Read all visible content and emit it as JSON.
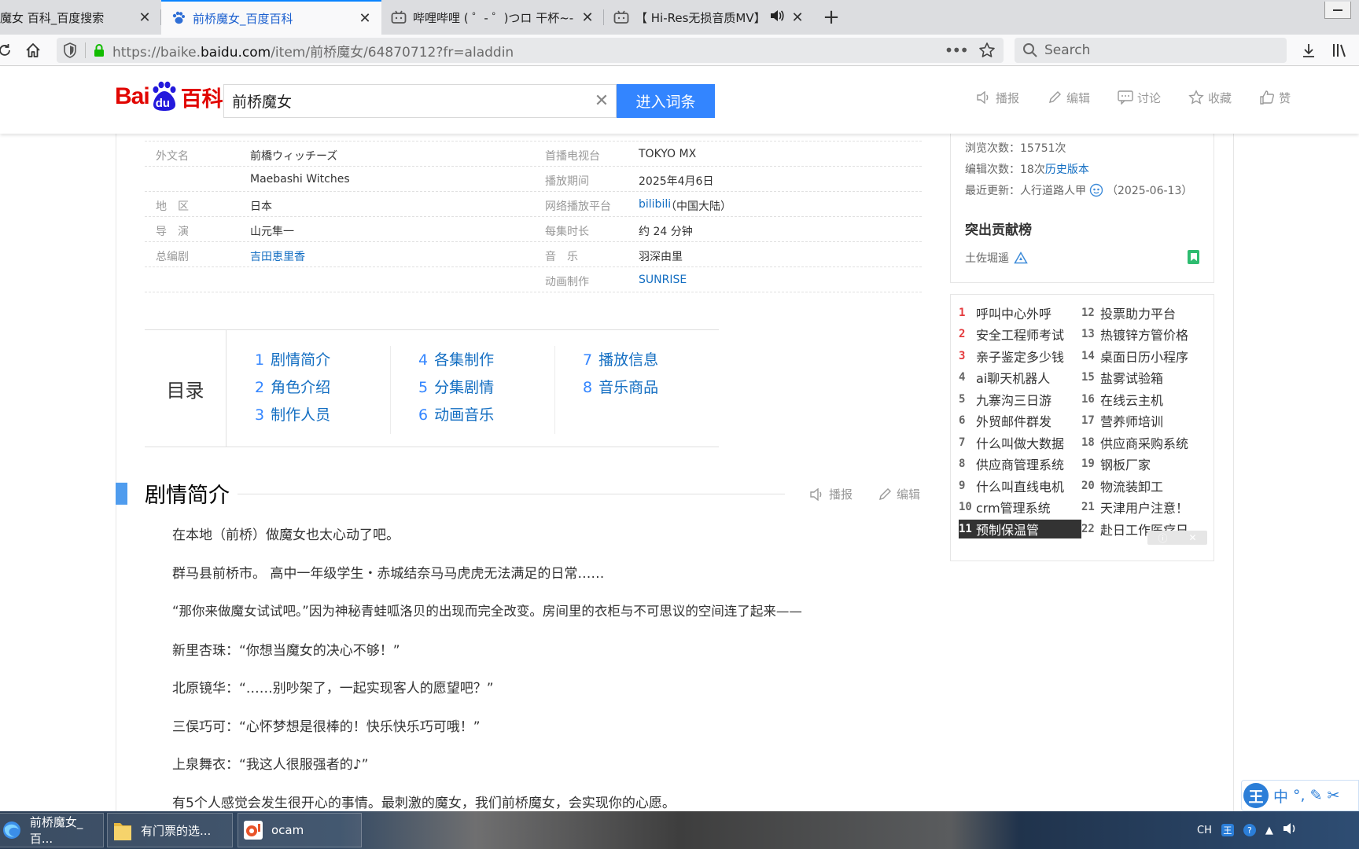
{
  "browser": {
    "tabs": [
      {
        "title": "魔女 百科_百度搜索",
        "active": false
      },
      {
        "title": "前桥魔女_百度百科",
        "active": true
      },
      {
        "title": "哔哩哔哩 ( ゜- ゜)つロ 干杯~-bi",
        "active": false
      },
      {
        "title": "【 Hi-Res无损音质MV】 前",
        "active": false
      }
    ],
    "url_prefix": "https://baike.",
    "url_domain": "baidu.com",
    "url_suffix": "/item/前桥魔女/64870712?fr=aladdin",
    "search_placeholder": "Search"
  },
  "header": {
    "logo_bai": "Bai",
    "logo_du": "du",
    "logo_baike": "百科",
    "search_value": "前桥魔女",
    "enter_button": "进入词条",
    "actions": [
      "播报",
      "编辑",
      "讨论",
      "收藏",
      "赞"
    ]
  },
  "basic_info": {
    "left": [
      {
        "label": "外文名",
        "value": "前橋ウィッチーズ",
        "link": false
      },
      {
        "label": "",
        "value": "Maebashi Witches",
        "link": false
      },
      {
        "label": "地　区",
        "value": "日本",
        "link": false
      },
      {
        "label": "导　演",
        "value": "山元隼一",
        "link": false
      },
      {
        "label": "总编剧",
        "value": "吉田恵里香",
        "link": true
      }
    ],
    "right": [
      {
        "label": "首播电视台",
        "value": "TOKYO MX",
        "link": false
      },
      {
        "label": "播放期间",
        "value": "2025年4月6日",
        "link": false
      },
      {
        "label": "网络播放平台",
        "value": "bilibili",
        "extra": "（中国大陆）",
        "link": true
      },
      {
        "label": "每集时长",
        "value": "约 24 分钟",
        "link": false
      },
      {
        "label": "音　乐",
        "value": "羽深由里",
        "link": false
      },
      {
        "label": "动画制作",
        "value": "SUNRISE",
        "link": true
      }
    ]
  },
  "toc": {
    "heading": "目录",
    "items": [
      {
        "num": "1",
        "label": "剧情简介"
      },
      {
        "num": "2",
        "label": "角色介绍"
      },
      {
        "num": "3",
        "label": "制作人员"
      },
      {
        "num": "4",
        "label": "各集制作"
      },
      {
        "num": "5",
        "label": "分集剧情"
      },
      {
        "num": "6",
        "label": "动画音乐"
      },
      {
        "num": "7",
        "label": "播放信息"
      },
      {
        "num": "8",
        "label": "音乐商品"
      }
    ]
  },
  "section": {
    "title": "剧情简介",
    "actions": [
      "播报",
      "编辑"
    ],
    "paragraphs": [
      "在本地（前桥）做魔女也太心动了吧。",
      "群马县前桥市。 高中一年级学生・赤城结奈马马虎虎无法满足的日常……",
      "“那你来做魔女试试吧。”因为神秘青蛙呱洛贝的出现而完全改变。房间里的衣柜与不可思议的空间连了起来——",
      "新里杏珠：“你想当魔女的决心不够！”",
      "北原镜华：“……别吵架了，一起实现客人的愿望吧？”",
      "三俣巧可：“心怀梦想是很棒的！快乐快乐巧可哦！”",
      "上泉舞衣：“我这人很服强者的♪”",
      "有5个人感觉会发生很开心的事情。最刺激的魔女，我们前桥魔女，会实现你的心愿。"
    ]
  },
  "sidebar": {
    "views": "浏览次数：15751次",
    "edits_prefix": "编辑次数：18次",
    "history_link": "历史版本",
    "updated_prefix": "最近更新：人行道路人甲",
    "updated_date": "（2025-06-13）",
    "contrib_heading": "突出贡献榜",
    "contributor": "土佐堀遥"
  },
  "hot_list": [
    {
      "num": "1",
      "label": "呼叫中心外呼"
    },
    {
      "num": "2",
      "label": "安全工程师考试"
    },
    {
      "num": "3",
      "label": "亲子鉴定多少钱"
    },
    {
      "num": "4",
      "label": "ai聊天机器人"
    },
    {
      "num": "5",
      "label": "九寨沟三日游"
    },
    {
      "num": "6",
      "label": "外贸邮件群发"
    },
    {
      "num": "7",
      "label": "什么叫做大数据"
    },
    {
      "num": "8",
      "label": "供应商管理系统"
    },
    {
      "num": "9",
      "label": "什么叫直线电机"
    },
    {
      "num": "10",
      "label": "crm管理系统"
    },
    {
      "num": "11",
      "label": "预制保温管"
    },
    {
      "num": "12",
      "label": "投票助力平台"
    },
    {
      "num": "13",
      "label": "热镀锌方管价格"
    },
    {
      "num": "14",
      "label": "桌面日历小程序"
    },
    {
      "num": "15",
      "label": "盐雾试验箱"
    },
    {
      "num": "16",
      "label": "在线云主机"
    },
    {
      "num": "17",
      "label": "营养师培训"
    },
    {
      "num": "18",
      "label": "供应商采购系统"
    },
    {
      "num": "19",
      "label": "钢板厂家"
    },
    {
      "num": "20",
      "label": "物流装卸工"
    },
    {
      "num": "21",
      "label": "天津用户注意！"
    },
    {
      "num": "22",
      "label": "赴日工作医疗日"
    }
  ],
  "ime": {
    "logo": "王",
    "mode": "中"
  },
  "taskbar": {
    "items": [
      "前桥魔女_百...",
      "有门票的选...",
      "ocam"
    ],
    "tray_lang": "CH"
  },
  "colors": {
    "baidu_red": "#e10602",
    "baike_blue": "#3385ff",
    "link": "#136ec2",
    "hot_red": "#e4393c"
  }
}
